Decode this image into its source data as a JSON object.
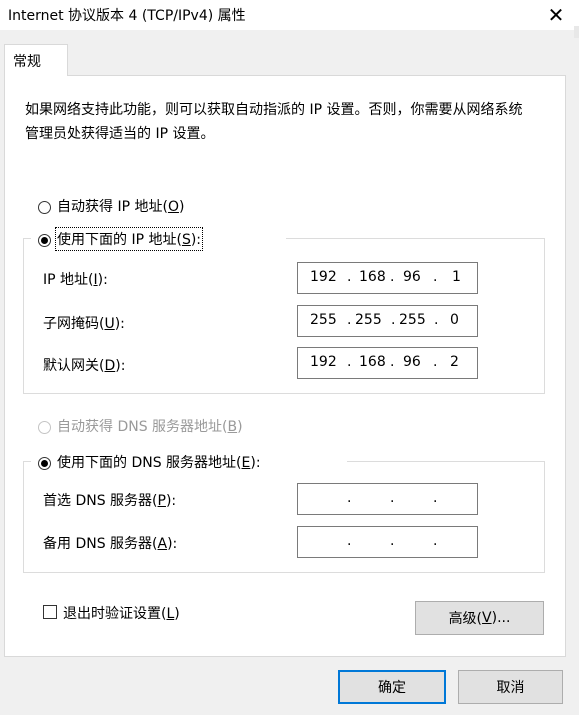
{
  "window": {
    "title": "Internet 协议版本 4 (TCP/IPv4) 属性",
    "close_glyph": "✕"
  },
  "tab": {
    "label": "常规"
  },
  "description": "如果网络支持此功能，则可以获取自动指派的 IP 设置。否则，你需要从网络系统管理员处获得适当的 IP 设置。",
  "ip_mode": {
    "auto": {
      "label": "自动获得 IP 地址(",
      "key": "O",
      "end": ")",
      "checked": false
    },
    "manual": {
      "label": "使用下面的 IP 地址(",
      "key": "S",
      "end": "):",
      "checked": true
    }
  },
  "ip_fields": [
    {
      "label": "IP 地址(",
      "key": "I",
      "end": "):",
      "octets": [
        "192",
        "168",
        "96",
        "1"
      ]
    },
    {
      "label": "子网掩码(",
      "key": "U",
      "end": "):",
      "octets": [
        "255",
        "255",
        "255",
        "0"
      ]
    },
    {
      "label": "默认网关(",
      "key": "D",
      "end": "):",
      "octets": [
        "192",
        "168",
        "96",
        "2"
      ]
    }
  ],
  "dns_mode": {
    "auto": {
      "label": "自动获得 DNS 服务器地址(",
      "key": "B",
      "end": ")",
      "enabled": false
    },
    "manual": {
      "label": "使用下面的 DNS 服务器地址(",
      "key": "E",
      "end": "):",
      "checked": true
    }
  },
  "dns_fields": [
    {
      "label": "首选 DNS 服务器(",
      "key": "P",
      "end": "):",
      "octets": [
        "",
        "",
        "",
        ""
      ]
    },
    {
      "label": "备用 DNS 服务器(",
      "key": "A",
      "end": "):",
      "octets": [
        "",
        "",
        "",
        ""
      ]
    }
  ],
  "validate_on_exit": {
    "label": "退出时验证设置(",
    "key": "L",
    "end": ")",
    "checked": false
  },
  "buttons": {
    "advanced": {
      "label": "高级(",
      "key": "V",
      "end": ")..."
    },
    "ok": "确定",
    "cancel": "取消"
  },
  "dot": "."
}
